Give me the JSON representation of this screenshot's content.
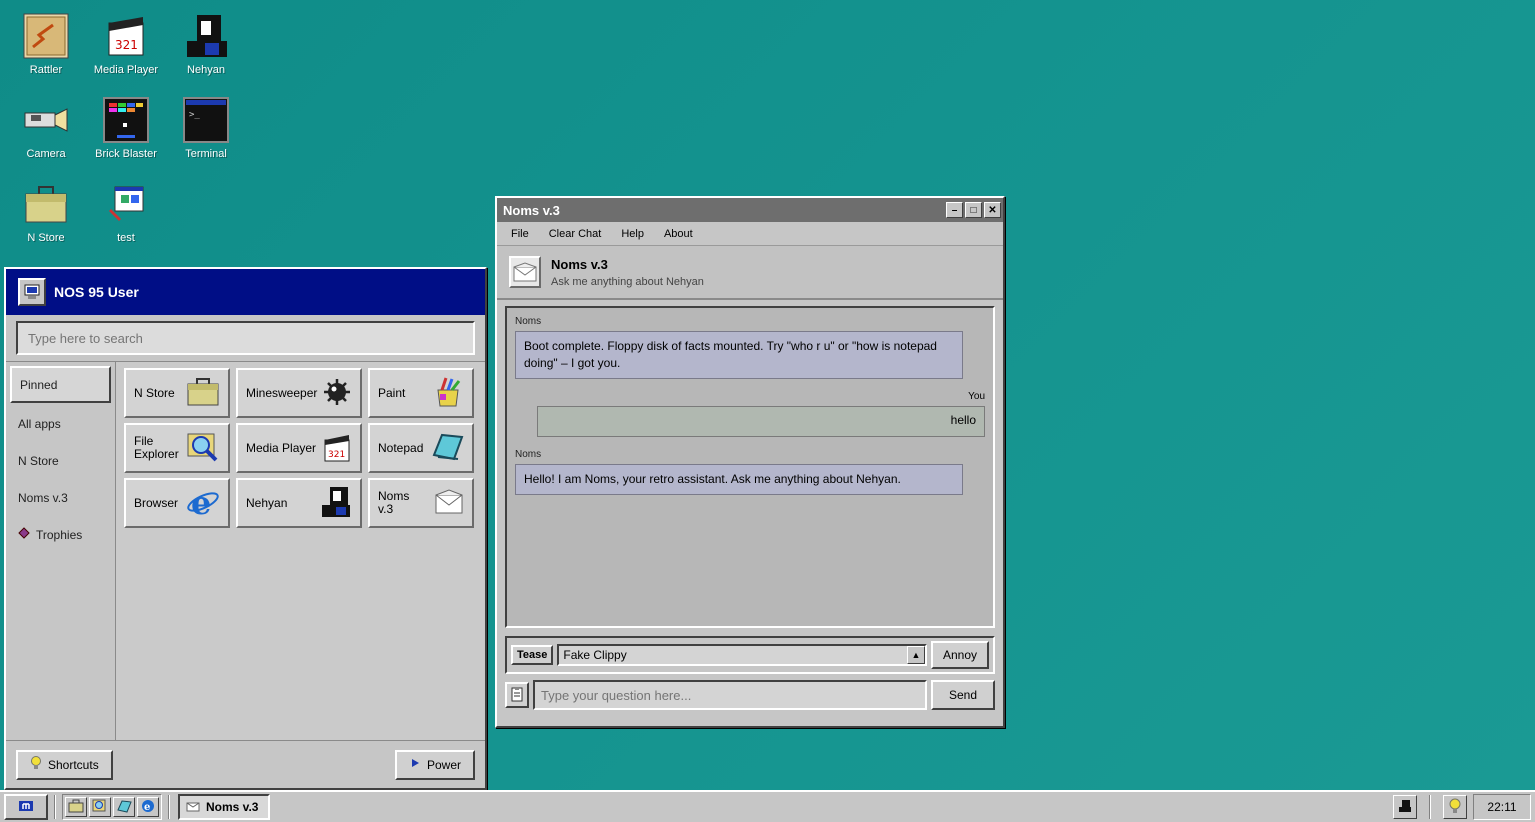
{
  "desktop": {
    "icons": [
      {
        "label": "Rattler",
        "icon": "rattler-icon"
      },
      {
        "label": "Media Player",
        "icon": "media-player-icon"
      },
      {
        "label": "Nehyan",
        "icon": "nehyan-icon"
      },
      {
        "label": "Camera",
        "icon": "camera-icon"
      },
      {
        "label": "Brick Blaster",
        "icon": "brick-blaster-icon"
      },
      {
        "label": "Terminal",
        "icon": "terminal-icon"
      },
      {
        "label": "N Store",
        "icon": "n-store-icon"
      },
      {
        "label": "test",
        "icon": "test-icon"
      }
    ]
  },
  "start_menu": {
    "user": "NOS 95 User",
    "search_placeholder": "Type here to search",
    "side": [
      "Pinned",
      "All apps",
      "N Store",
      "Noms v.3",
      "Trophies"
    ],
    "tiles": [
      {
        "label": "N Store",
        "icon": "n-store-icon"
      },
      {
        "label": "Minesweeper",
        "icon": "mine-icon"
      },
      {
        "label": "Paint",
        "icon": "paint-icon"
      },
      {
        "label": "File Explorer",
        "icon": "file-explorer-icon"
      },
      {
        "label": "Media Player",
        "icon": "media-player-icon"
      },
      {
        "label": "Notepad",
        "icon": "notepad-icon"
      },
      {
        "label": "Browser",
        "icon": "browser-icon"
      },
      {
        "label": "Nehyan",
        "icon": "nehyan-icon"
      },
      {
        "label": "Noms v.3",
        "icon": "mail-icon"
      }
    ],
    "shortcuts_label": "Shortcuts",
    "power_label": "Power"
  },
  "noms": {
    "title": "Noms v.3",
    "menu": [
      "File",
      "Clear Chat",
      "Help",
      "About"
    ],
    "header_title": "Noms v.3",
    "header_sub": "Ask me anything about Nehyan",
    "messages": [
      {
        "who": "Noms",
        "text": "Boot complete. Floppy disk of facts mounted. Try \"who r u\" or \"how is notepad doing\" – I got you."
      },
      {
        "who": "You",
        "text": "hello"
      },
      {
        "who": "Noms",
        "text": "Hello! I am Noms, your retro assistant. Ask me anything about Nehyan."
      }
    ],
    "tease_label": "Tease",
    "tease_selected": "Fake Clippy",
    "annoy_label": "Annoy",
    "input_placeholder": "Type your question here...",
    "send_label": "Send"
  },
  "taskbar": {
    "task_label": "Noms v.3",
    "clock": "22:11"
  }
}
